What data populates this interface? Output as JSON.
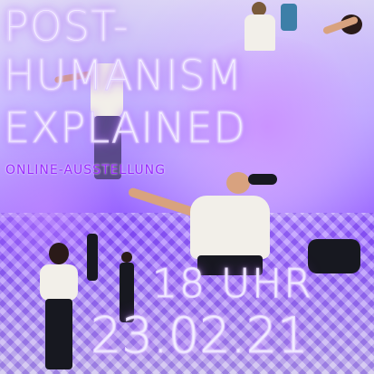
{
  "poster": {
    "title_lines": [
      "POST-",
      "HUMANISM",
      "EXPLAINED"
    ],
    "subtitle": "ONLINE-AUSSTELLUNG",
    "time": "18 UHR",
    "date": "23.02.21"
  },
  "colors": {
    "accent_purple": "#9b2cff",
    "glow": "#c18cff",
    "text": "#f3efff"
  }
}
